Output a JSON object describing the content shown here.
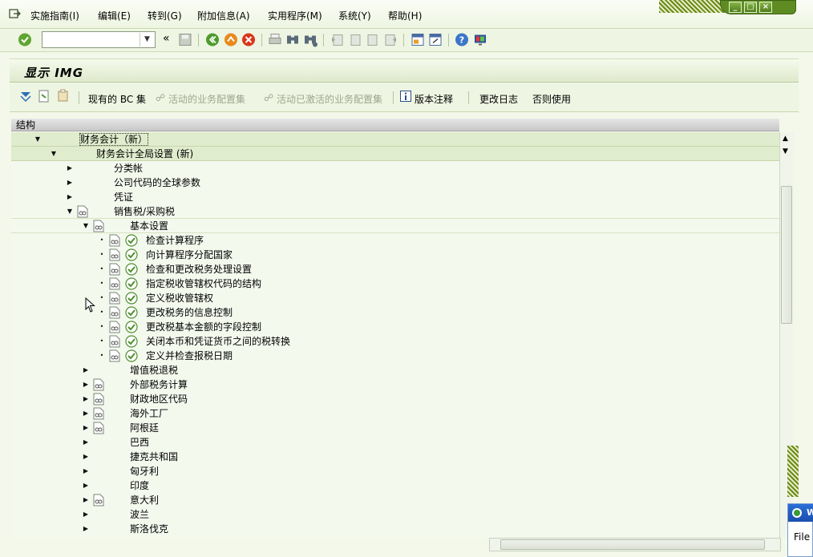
{
  "menu": {
    "items": [
      "实施指南(I)",
      "编辑(E)",
      "转到(G)",
      "附加信息(A)",
      "实用程序(M)",
      "系统(Y)",
      "帮助(H)"
    ]
  },
  "window_controls": {
    "minimize": "_",
    "restore": "□",
    "close": "×"
  },
  "toolbar": {
    "command_field_value": "",
    "nav_back_glyph": "«",
    "icons": [
      "enter-icon",
      "save-icon",
      "back-icon",
      "exit-icon",
      "cancel-icon",
      "print-icon",
      "find-icon",
      "find-next-icon",
      "first-page-icon",
      "previous-page-icon",
      "next-page-icon",
      "last-page-icon",
      "new-session-icon",
      "shortcut-icon",
      "help-icon",
      "customize-layout-icon"
    ]
  },
  "screen": {
    "title": "显示 IMG"
  },
  "app_toolbar": {
    "current_bc_set": "现有的 BC 集",
    "active_business_config_set": "活动的业务配置集",
    "activated_business_config_set": "活动已激活的业务配置集",
    "release_notes": "版本注释",
    "change_log": "更改日志",
    "where_used": "否则使用"
  },
  "tree": {
    "header": "结构",
    "rows": [
      {
        "label": "财务会计（新）",
        "level": 0,
        "toggle": "expanded",
        "doc": false,
        "exec": false,
        "style": "hl",
        "focus": true
      },
      {
        "label": "财务会计全局设置 (新)",
        "level": 1,
        "toggle": "expanded",
        "doc": false,
        "exec": false,
        "style": "hl"
      },
      {
        "label": "分类帐",
        "level": 2,
        "toggle": "collapsed",
        "doc": false,
        "exec": false
      },
      {
        "label": "公司代码的全球参数",
        "level": 2,
        "toggle": "collapsed",
        "doc": false,
        "exec": false
      },
      {
        "label": "凭证",
        "level": 2,
        "toggle": "collapsed",
        "doc": false,
        "exec": false
      },
      {
        "label": "销售税/采购税",
        "level": 2,
        "toggle": "expanded",
        "doc": true,
        "exec": false,
        "style": "ln"
      },
      {
        "label": "基本设置",
        "level": 3,
        "toggle": "expanded",
        "doc": true,
        "exec": false,
        "style": "ln"
      },
      {
        "label": "检查计算程序",
        "level": 4,
        "toggle": "leaf",
        "doc": true,
        "exec": true
      },
      {
        "label": "向计算程序分配国家",
        "level": 4,
        "toggle": "leaf",
        "doc": true,
        "exec": true
      },
      {
        "label": "检查和更改税务处理设置",
        "level": 4,
        "toggle": "leaf",
        "doc": true,
        "exec": true
      },
      {
        "label": "指定税收管辖权代码的结构",
        "level": 4,
        "toggle": "leaf",
        "doc": true,
        "exec": true
      },
      {
        "label": "定义税收管辖权",
        "level": 4,
        "toggle": "leaf",
        "doc": true,
        "exec": true
      },
      {
        "label": "更改税务的信息控制",
        "level": 4,
        "toggle": "leaf",
        "doc": true,
        "exec": true
      },
      {
        "label": "更改税基本金额的字段控制",
        "level": 4,
        "toggle": "leaf",
        "doc": true,
        "exec": true
      },
      {
        "label": "关闭本币和凭证货币之间的税转换",
        "level": 4,
        "toggle": "leaf",
        "doc": true,
        "exec": true
      },
      {
        "label": "定义并检查报税日期",
        "level": 4,
        "toggle": "leaf",
        "doc": true,
        "exec": true
      },
      {
        "label": "增值税退税",
        "level": 3,
        "toggle": "collapsed",
        "doc": false,
        "exec": false
      },
      {
        "label": "外部税务计算",
        "level": 3,
        "toggle": "collapsed",
        "doc": true,
        "exec": false
      },
      {
        "label": "财政地区代码",
        "level": 3,
        "toggle": "collapsed",
        "doc": true,
        "exec": false
      },
      {
        "label": "海外工厂",
        "level": 3,
        "toggle": "collapsed",
        "doc": true,
        "exec": false
      },
      {
        "label": "阿根廷",
        "level": 3,
        "toggle": "collapsed",
        "doc": true,
        "exec": false
      },
      {
        "label": "巴西",
        "level": 3,
        "toggle": "collapsed",
        "doc": false,
        "exec": false
      },
      {
        "label": "捷克共和国",
        "level": 3,
        "toggle": "collapsed",
        "doc": false,
        "exec": false
      },
      {
        "label": "匈牙利",
        "level": 3,
        "toggle": "collapsed",
        "doc": false,
        "exec": false
      },
      {
        "label": "印度",
        "level": 3,
        "toggle": "collapsed",
        "doc": false,
        "exec": false
      },
      {
        "label": "意大利",
        "level": 3,
        "toggle": "collapsed",
        "doc": true,
        "exec": false
      },
      {
        "label": "波兰",
        "level": 3,
        "toggle": "collapsed",
        "doc": false,
        "exec": false
      },
      {
        "label": "斯洛伐克",
        "level": 3,
        "toggle": "collapsed",
        "doc": false,
        "exec": false
      }
    ]
  },
  "external_window": {
    "title": "W",
    "menu": "File"
  }
}
